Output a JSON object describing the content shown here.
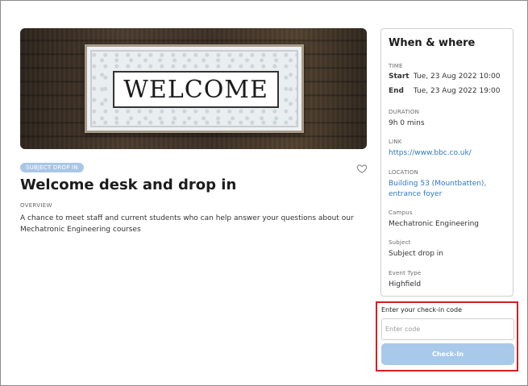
{
  "hero": {
    "sign_text": "WELCOME"
  },
  "event": {
    "tag": "SUBJECT DROP IN",
    "title": "Welcome desk and drop in",
    "overview_label": "OVERVIEW",
    "overview_text": "A chance to meet staff and current students who can help answer your questions about our Mechatronic Engineering courses",
    "favourite_icon": "heart-outline-icon"
  },
  "when_where": {
    "title": "When & where",
    "time_label": "TIME",
    "start_key": "Start",
    "start_value": "Tue, 23 Aug 2022 10:00",
    "end_key": "End",
    "end_value": "Tue, 23 Aug 2022 19:00",
    "duration_label": "DURATION",
    "duration_value": "9h 0 mins",
    "link_label": "LINK",
    "link_value": "https://www.bbc.co.uk/",
    "location_label": "LOCATION",
    "location_value": "Building 53 (Mountbatten), entrance foyer",
    "campus_label": "Campus",
    "campus_value": "Mechatronic Engineering",
    "subject_label": "Subject",
    "subject_value": "Subject drop in",
    "event_type_label": "Event Type",
    "event_type_value": "Highfield"
  },
  "checkin": {
    "label": "Enter your check-in code",
    "placeholder": "Enter code",
    "button_label": "Check-In"
  },
  "colors": {
    "link": "#2c79c3",
    "tag_bg": "#a9c6e8",
    "button_bg": "#a9c9ea",
    "highlight_border": "#d62020"
  }
}
